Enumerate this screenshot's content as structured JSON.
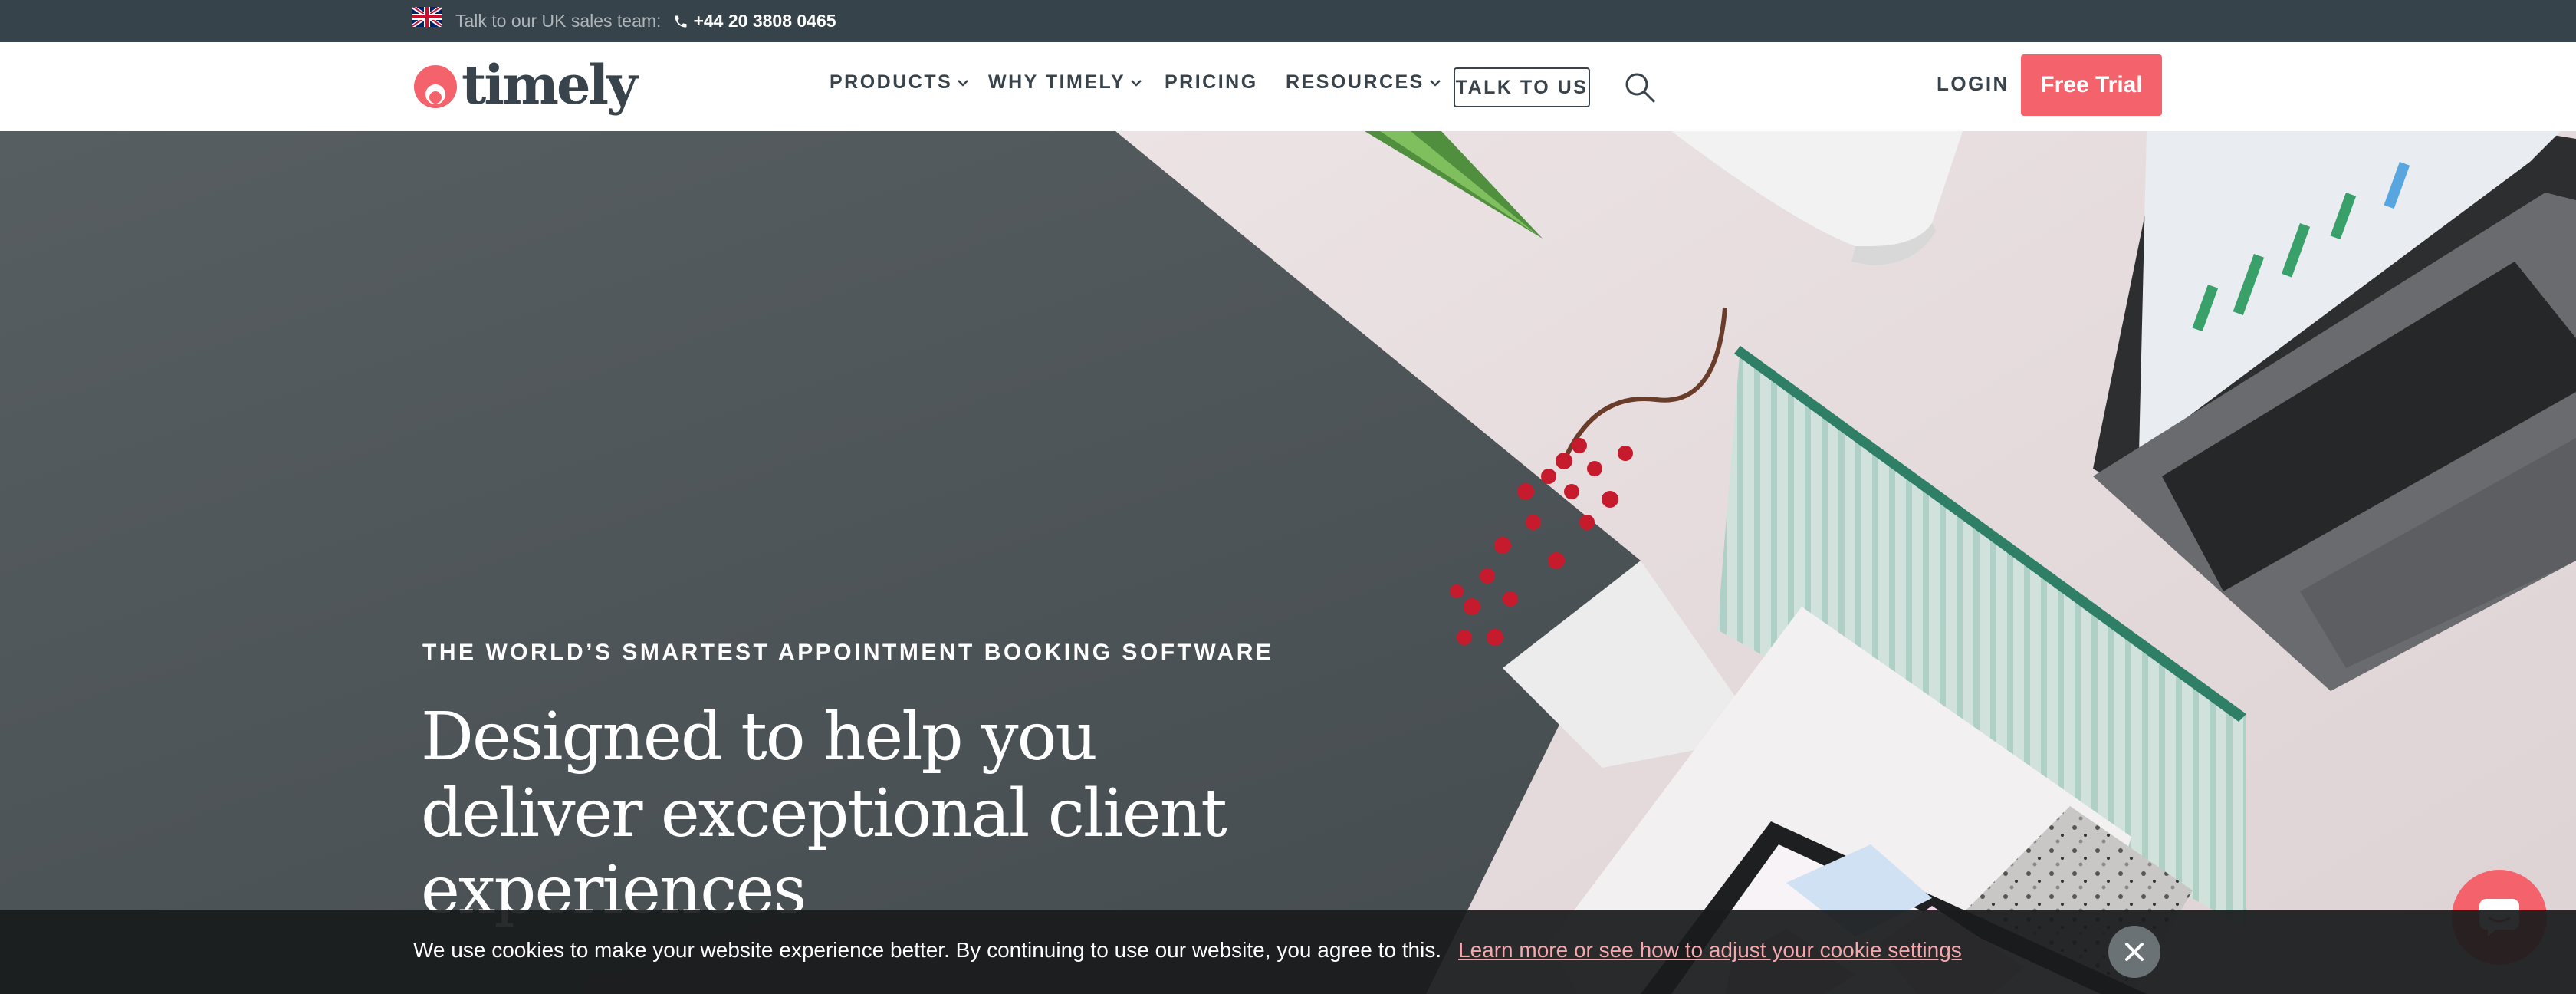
{
  "topbar": {
    "flag_icon": "uk-flag-icon",
    "talk_label": "Talk to our UK sales team:",
    "phone_icon": "phone-icon",
    "phone_number": "+44 20 3808 0465"
  },
  "navbar": {
    "logo_text": "timely",
    "items": [
      {
        "label": "PRODUCTS",
        "has_dropdown": true
      },
      {
        "label": "WHY TIMELY",
        "has_dropdown": true
      },
      {
        "label": "PRICING",
        "has_dropdown": false
      },
      {
        "label": "RESOURCES",
        "has_dropdown": true
      }
    ],
    "talk_to_us": "TALK TO US",
    "search_icon": "search-icon",
    "login": "LOGIN",
    "free_trial": "Free Trial"
  },
  "hero": {
    "eyebrow": "THE WORLD’S SMARTEST APPOINTMENT BOOKING SOFTWARE",
    "headline_lines": [
      "Designed to help you",
      "deliver exceptional client",
      "experiences"
    ]
  },
  "cookie_banner": {
    "text": "We use cookies to make your website experience better. By continuing to use our website, you agree to this.",
    "link": "Learn more or see how to adjust your cookie settings",
    "close_icon": "close-icon"
  },
  "chat": {
    "icon": "chat-icon"
  },
  "colors": {
    "brand_coral": "#f4626b",
    "topbar_bg": "#37434a",
    "text_dark": "#38434b",
    "hero_dark": "#4b5257"
  }
}
